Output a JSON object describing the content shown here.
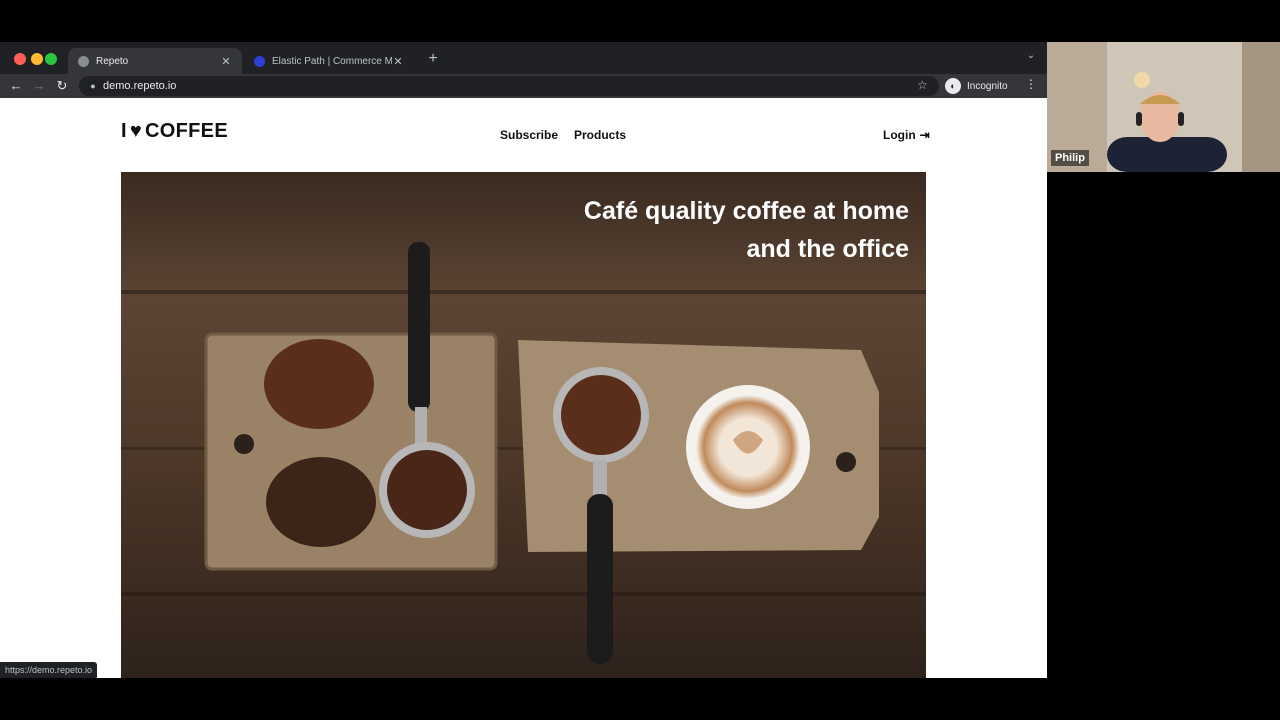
{
  "browser": {
    "tabs": [
      {
        "title": "Repeto",
        "active": true
      },
      {
        "title": "Elastic Path | Commerce Mana",
        "active": false
      }
    ],
    "url": "demo.repeto.io",
    "incognito_label": "Incognito",
    "status_url": "https://demo.repeto.io",
    "icons": {
      "back": "arrow-left",
      "forward": "arrow-right",
      "reload": "reload",
      "star": "star",
      "menu": "kebab"
    }
  },
  "site": {
    "logo_left": "I",
    "logo_right": "COFFEE",
    "nav": {
      "subscribe": "Subscribe",
      "products": "Products"
    },
    "login": "Login",
    "hero": {
      "line1": "Café quality coffee at home",
      "line2": "and the office"
    }
  },
  "video": {
    "name": "Philip"
  },
  "colors": {
    "tabstrip": "#202124",
    "toolbar": "#35363a",
    "text_dark": "#111111",
    "hero_text": "#ffffff"
  }
}
